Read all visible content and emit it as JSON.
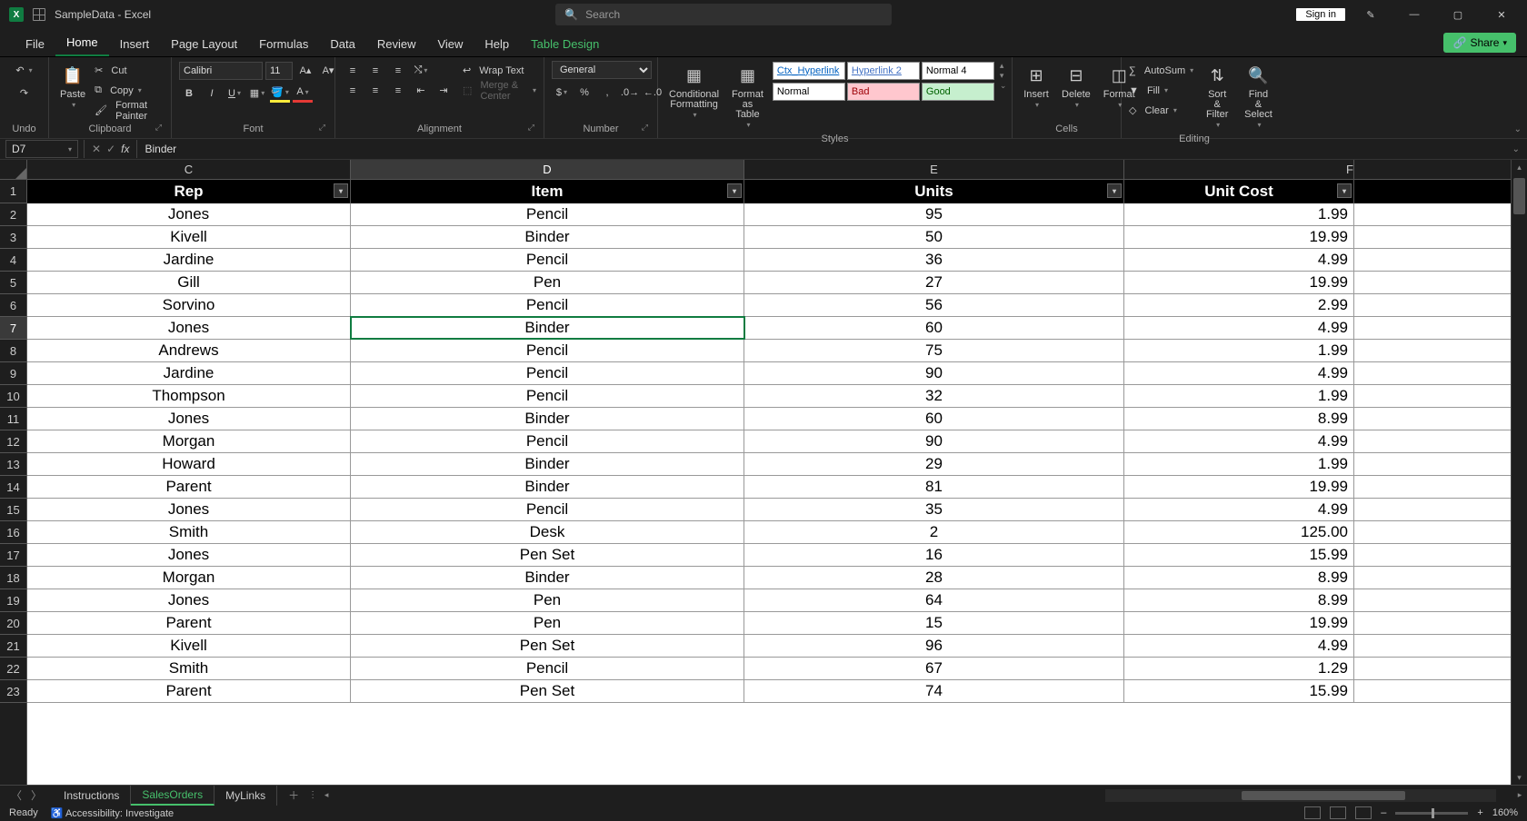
{
  "title": "SampleData - Excel",
  "search_placeholder": "Search",
  "signin": "Sign in",
  "tabs": {
    "file": "File",
    "home": "Home",
    "insert": "Insert",
    "pagelayout": "Page Layout",
    "formulas": "Formulas",
    "data": "Data",
    "review": "Review",
    "view": "View",
    "help": "Help",
    "tabledesign": "Table Design"
  },
  "share": "Share",
  "ribbon": {
    "undo_label": "Undo",
    "paste": "Paste",
    "cut": "Cut",
    "copy": "Copy",
    "fmtpainter": "Format Painter",
    "clipboard": "Clipboard",
    "font_name": "Calibri",
    "font_size": "11",
    "font_label": "Font",
    "wrap": "Wrap Text",
    "merge": "Merge & Center",
    "align_label": "Alignment",
    "numfmt": "General",
    "number_label": "Number",
    "condfmt": "Conditional",
    "condfmt2": "Formatting",
    "astable": "Format as",
    "astable2": "Table",
    "style_ctx": "Ctx_Hyperlink",
    "style_hl2": "Hyperlink 2",
    "style_n4": "Normal 4",
    "style_normal": "Normal",
    "style_bad": "Bad",
    "style_good": "Good",
    "styles_label": "Styles",
    "insert": "Insert",
    "delete": "Delete",
    "format": "Format",
    "cells_label": "Cells",
    "autosum": "AutoSum",
    "fill": "Fill",
    "clear": "Clear",
    "sortfilter": "Sort &",
    "sortfilter2": "Filter",
    "findsel": "Find &",
    "findsel2": "Select",
    "editing_label": "Editing"
  },
  "namebox": "D7",
  "formula": "Binder",
  "columns": [
    "C",
    "D",
    "E",
    "F"
  ],
  "headers": {
    "rep": "Rep",
    "item": "Item",
    "units": "Units",
    "unitcost": "Unit Cost"
  },
  "rows": [
    {
      "n": "2",
      "rep": "Jones",
      "item": "Pencil",
      "units": "95",
      "cost": "1.99"
    },
    {
      "n": "3",
      "rep": "Kivell",
      "item": "Binder",
      "units": "50",
      "cost": "19.99"
    },
    {
      "n": "4",
      "rep": "Jardine",
      "item": "Pencil",
      "units": "36",
      "cost": "4.99"
    },
    {
      "n": "5",
      "rep": "Gill",
      "item": "Pen",
      "units": "27",
      "cost": "19.99"
    },
    {
      "n": "6",
      "rep": "Sorvino",
      "item": "Pencil",
      "units": "56",
      "cost": "2.99"
    },
    {
      "n": "7",
      "rep": "Jones",
      "item": "Binder",
      "units": "60",
      "cost": "4.99"
    },
    {
      "n": "8",
      "rep": "Andrews",
      "item": "Pencil",
      "units": "75",
      "cost": "1.99"
    },
    {
      "n": "9",
      "rep": "Jardine",
      "item": "Pencil",
      "units": "90",
      "cost": "4.99"
    },
    {
      "n": "10",
      "rep": "Thompson",
      "item": "Pencil",
      "units": "32",
      "cost": "1.99"
    },
    {
      "n": "11",
      "rep": "Jones",
      "item": "Binder",
      "units": "60",
      "cost": "8.99"
    },
    {
      "n": "12",
      "rep": "Morgan",
      "item": "Pencil",
      "units": "90",
      "cost": "4.99"
    },
    {
      "n": "13",
      "rep": "Howard",
      "item": "Binder",
      "units": "29",
      "cost": "1.99"
    },
    {
      "n": "14",
      "rep": "Parent",
      "item": "Binder",
      "units": "81",
      "cost": "19.99"
    },
    {
      "n": "15",
      "rep": "Jones",
      "item": "Pencil",
      "units": "35",
      "cost": "4.99"
    },
    {
      "n": "16",
      "rep": "Smith",
      "item": "Desk",
      "units": "2",
      "cost": "125.00"
    },
    {
      "n": "17",
      "rep": "Jones",
      "item": "Pen Set",
      "units": "16",
      "cost": "15.99"
    },
    {
      "n": "18",
      "rep": "Morgan",
      "item": "Binder",
      "units": "28",
      "cost": "8.99"
    },
    {
      "n": "19",
      "rep": "Jones",
      "item": "Pen",
      "units": "64",
      "cost": "8.99"
    },
    {
      "n": "20",
      "rep": "Parent",
      "item": "Pen",
      "units": "15",
      "cost": "19.99"
    },
    {
      "n": "21",
      "rep": "Kivell",
      "item": "Pen Set",
      "units": "96",
      "cost": "4.99"
    },
    {
      "n": "22",
      "rep": "Smith",
      "item": "Pencil",
      "units": "67",
      "cost": "1.29"
    },
    {
      "n": "23",
      "rep": "Parent",
      "item": "Pen Set",
      "units": "74",
      "cost": "15.99"
    }
  ],
  "sheets": {
    "s1": "Instructions",
    "s2": "SalesOrders",
    "s3": "MyLinks"
  },
  "status": {
    "ready": "Ready",
    "access": "Accessibility: Investigate",
    "zoom": "160%"
  }
}
